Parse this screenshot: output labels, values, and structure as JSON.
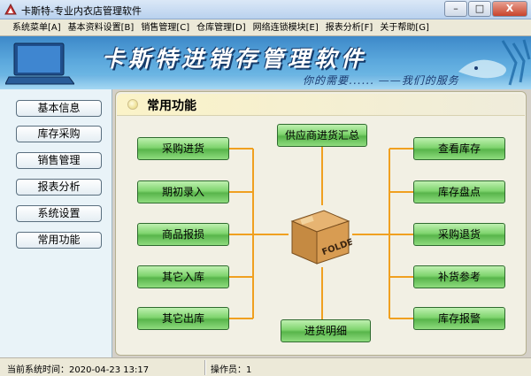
{
  "window": {
    "title": "卡斯特-专业内衣店管理软件",
    "buttons": [
      "–",
      "□",
      "X"
    ]
  },
  "menu": [
    "系统菜单[A]",
    "基本资料设置[B]",
    "销售管理[C]",
    "仓库管理[D]",
    "网络连锁模块[E]",
    "报表分析[F]",
    "关于帮助[G]"
  ],
  "banner": {
    "title": "卡斯特进销存管理软件",
    "slogan": "你的需要...... ——我们的服务"
  },
  "sidebar": [
    "基本信息",
    "库存采购",
    "销售管理",
    "报表分析",
    "系统设置",
    "常用功能"
  ],
  "panel": {
    "title": "常用功能"
  },
  "functions": {
    "top": "供应商进货汇总",
    "bottom": "进货明细",
    "left": [
      "采购进货",
      "期初录入",
      "商品报损",
      "其它入库",
      "其它出库"
    ],
    "right": [
      "查看库存",
      "库存盘点",
      "采购退货",
      "补货参考",
      "库存报警"
    ],
    "center_label": "FOLDER"
  },
  "status": {
    "time": "当前系统时间：2020-04-23 13:17",
    "operator": "操作员：1"
  },
  "colors": {
    "button_green": "#7fd46e",
    "connector": "#f0a020",
    "banner_blue": "#5aa7dc"
  }
}
